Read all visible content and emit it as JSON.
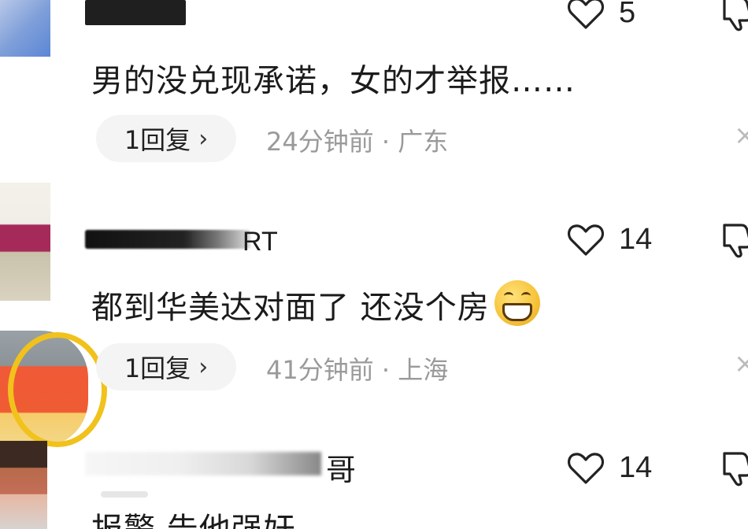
{
  "comments": [
    {
      "text": "男的没兑现承诺，女的才举报……",
      "likes": "5",
      "reply_label": "1回复",
      "meta": "24分钟前 · 广东"
    },
    {
      "username_tail": "RT",
      "text": "都到华美达对面了 还没个房",
      "emoji_icon": "grinning-face-icon",
      "likes": "14",
      "reply_label": "1回复",
      "meta": "41分钟前 · 上海"
    },
    {
      "username_tail": "哥",
      "text": "报警 告他强奸",
      "likes": "14"
    }
  ],
  "icons": {
    "reply_chevron": "›",
    "close": "×"
  },
  "colors": {
    "text": "#1b1b1b",
    "meta": "#9a9a9a",
    "pill_bg": "#f4f4f4",
    "avatar_frame": "#f1c21b"
  }
}
